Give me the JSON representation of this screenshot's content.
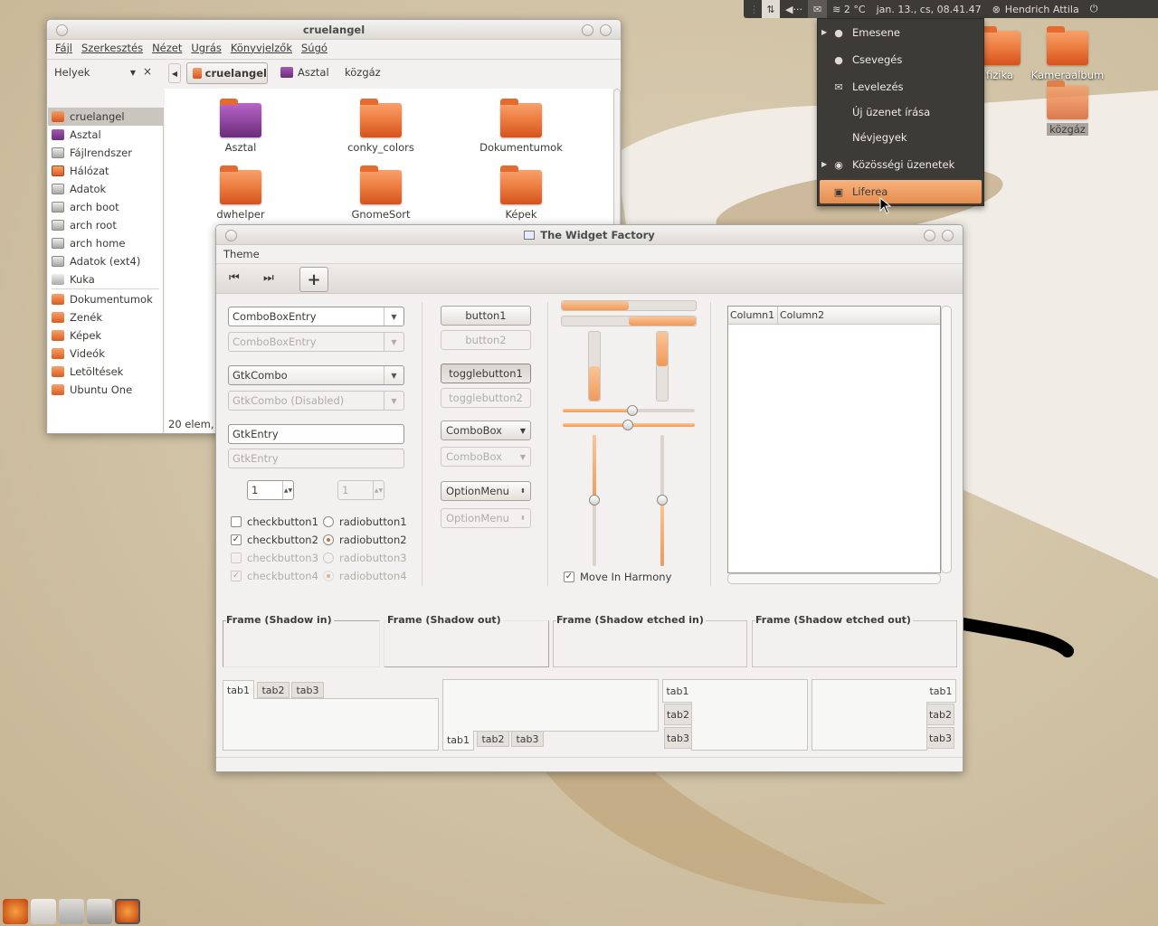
{
  "panel": {
    "indicator_arrows": "⇅",
    "volume": "◀···",
    "weather": "≋ 2 °C",
    "clock": "jan. 13., cs, 08.41.47",
    "user": "Hendrich Attila",
    "power": "⏻"
  },
  "indicator_menu": {
    "items": [
      {
        "label": "Emesene",
        "has_arrow": true,
        "icon": "people-icon"
      },
      {
        "label": "Csevegés",
        "has_arrow": false,
        "icon": "chat-bubble-icon"
      },
      {
        "label": "Levelezés",
        "has_arrow": false,
        "icon": "envelope-icon"
      },
      {
        "label": "Új üzenet írása",
        "has_arrow": false,
        "icon": ""
      },
      {
        "label": "Névjegyek",
        "has_arrow": false,
        "icon": ""
      },
      {
        "label": "Közösségi üzenetek",
        "has_arrow": true,
        "icon": "gwibber-icon"
      },
      {
        "label": "Liferea",
        "has_arrow": false,
        "icon": "rss-icon",
        "highlighted": true
      }
    ]
  },
  "desktop_icons": [
    {
      "label": "fizika"
    },
    {
      "label": "Kameraalbum"
    },
    {
      "label": "közgáz"
    }
  ],
  "nautilus": {
    "title": "cruelangel",
    "menu": [
      "Fájl",
      "Szerkesztés",
      "Nézet",
      "Ugrás",
      "Könyvjelzők",
      "Súgó"
    ],
    "places_label": "Helyek",
    "close": "×",
    "path": [
      "cruelangel",
      "Asztal",
      "közgáz"
    ],
    "sidebar": [
      {
        "label": "cruelangel",
        "icon": "home",
        "selected": true
      },
      {
        "label": "Asztal",
        "icon": "desk"
      },
      {
        "label": "Fájlrendszer",
        "icon": "drive"
      },
      {
        "label": "Hálózat",
        "icon": "doc"
      },
      {
        "label": "Adatok",
        "icon": "drive"
      },
      {
        "label": "arch boot",
        "icon": "drive"
      },
      {
        "label": "arch root",
        "icon": "drive"
      },
      {
        "label": "arch home",
        "icon": "drive"
      },
      {
        "label": "Adatok (ext4)",
        "icon": "drive"
      },
      {
        "label": "Kuka",
        "icon": "trash"
      },
      {
        "label": "Dokumentumok",
        "icon": "folder"
      },
      {
        "label": "Zenék",
        "icon": "folder"
      },
      {
        "label": "Képek",
        "icon": "folder"
      },
      {
        "label": "Videók",
        "icon": "folder"
      },
      {
        "label": "Letöltések",
        "icon": "folder"
      },
      {
        "label": "Ubuntu One",
        "icon": "folder"
      }
    ],
    "files": [
      "Asztal",
      "conky_colors",
      "Dokumentumok",
      "dwhelper",
      "GnomeSort",
      "Képek"
    ],
    "status": "20 elem,"
  },
  "factory": {
    "title": "The Widget Factory",
    "menu": "Theme",
    "combo1": "ComboBoxEntry",
    "combo1_dis": "ComboBoxEntry",
    "combo2": "GtkCombo",
    "combo2_dis": "GtkCombo (Disabled)",
    "entry": "GtkEntry",
    "entry_dis": "GtkEntry",
    "spin": "1",
    "spin_dis": "1",
    "checks": [
      "checkbutton1",
      "checkbutton2",
      "checkbutton3",
      "checkbutton4"
    ],
    "radios": [
      "radiobutton1",
      "radiobutton2",
      "radiobutton3",
      "radiobutton4"
    ],
    "buttons": [
      "button1",
      "button2",
      "togglebutton1",
      "togglebutton2",
      "ComboBox",
      "ComboBox",
      "OptionMenu",
      "OptionMenu"
    ],
    "harmony": "Move In Harmony",
    "progress": {
      "top_h": 0.5,
      "top_h2": 0.5,
      "v_left": 0.5,
      "v_right": 0.5
    },
    "scale": {
      "h1": 0.5,
      "h2": 0.5,
      "v1": 0.5,
      "v2": 0.5
    },
    "columns": [
      "Column1",
      "Column2"
    ],
    "frames": [
      "Frame (Shadow in)",
      "Frame (Shadow out)",
      "Frame (Shadow etched in)",
      "Frame (Shadow etched out)"
    ],
    "tabs": [
      "tab1",
      "tab2",
      "tab3"
    ]
  },
  "dock": [
    "firefox-icon",
    "files-icon",
    "trash-icon",
    "trash-full-icon",
    "firefox-icon"
  ]
}
